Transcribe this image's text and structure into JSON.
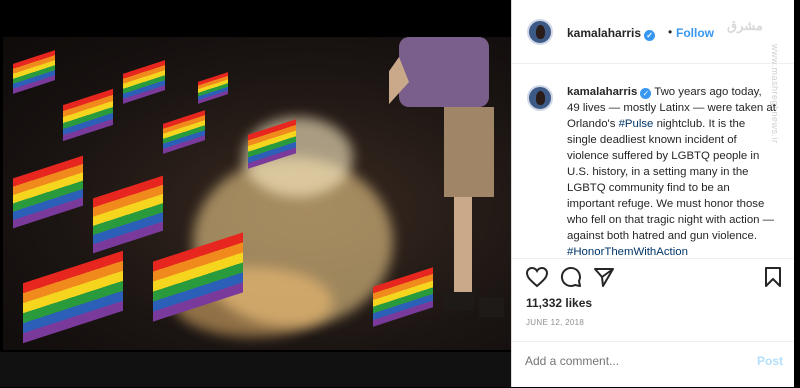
{
  "header": {
    "username": "kamalaharris",
    "follow_label": "Follow",
    "dot": "•"
  },
  "watermark": {
    "main": "مشرق",
    "side": "www.mashreghnews.ir"
  },
  "caption": {
    "username": "kamalaharris",
    "text_1": " Two years ago today, 49 lives — mostly Latinx — were taken at Orlando's ",
    "hashtag_1": "#Pulse",
    "text_2": " nightclub. It is the single deadliest known incident of violence suffered by LGBTQ people in U.S. history, in a setting many in the LGBTQ community find to be an important refuge. We must honor those who fell on that tragic night with action — against both hatred and gun violence. ",
    "hashtag_2": "#HonorThemWithAction"
  },
  "actions": {
    "icons": [
      "heart-icon",
      "comment-icon",
      "share-icon",
      "bookmark-icon"
    ]
  },
  "likes": "11,332 likes",
  "date": "JUNE 12, 2018",
  "comment": {
    "placeholder": "Add a comment...",
    "post_label": "Post"
  },
  "colors": {
    "link_blue": "#3897f0",
    "hashtag": "#003569",
    "post_disabled": "#b2dffc"
  }
}
